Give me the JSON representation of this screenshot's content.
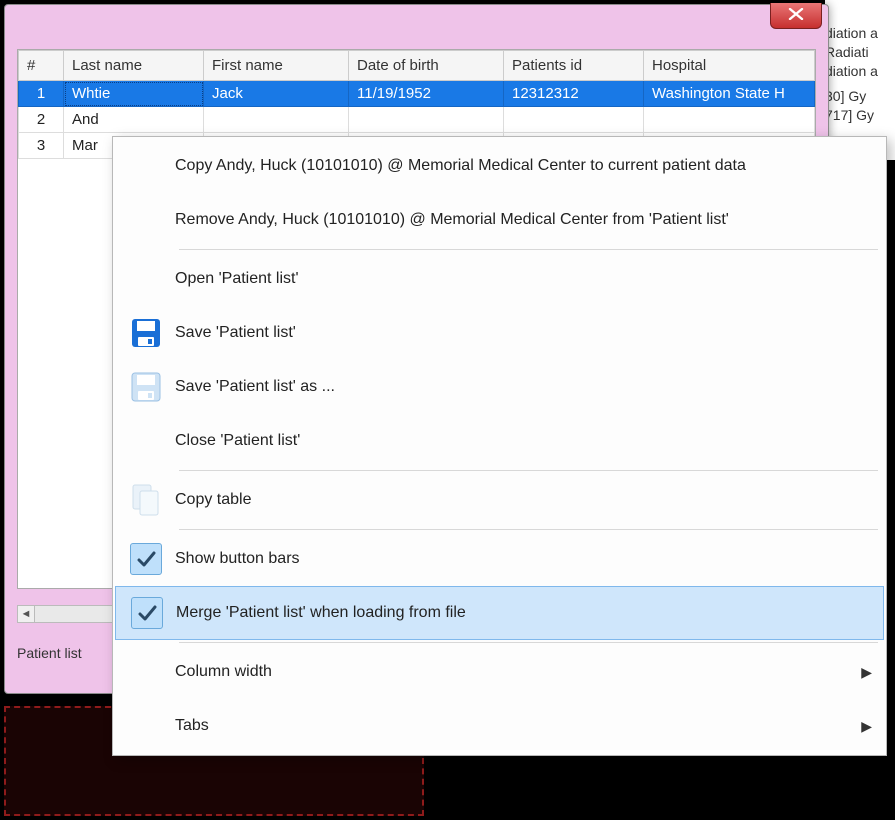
{
  "bg_right": {
    "l1": "diation a",
    "l2": "Radiati",
    "l3": "diation a",
    "l4": "30] Gy",
    "l5": "717] Gy"
  },
  "dialog": {
    "tab_label": "Patient list"
  },
  "table": {
    "headers": {
      "num": "#",
      "last": "Last name",
      "first": "First name",
      "dob": "Date of birth",
      "pid": "Patients id",
      "hosp": "Hospital"
    },
    "rows": [
      {
        "num": "1",
        "last": "Whtie",
        "first": "Jack",
        "dob": "11/19/1952",
        "pid": "12312312",
        "hosp": "Washington State H"
      },
      {
        "num": "2",
        "last": "And",
        "first": "",
        "dob": "",
        "pid": "",
        "hosp": ""
      },
      {
        "num": "3",
        "last": "Mar",
        "first": "",
        "dob": "",
        "pid": "",
        "hosp": ""
      }
    ]
  },
  "ctx": {
    "copy_current": "Copy Andy, Huck (10101010) @ Memorial Medical Center to current patient data",
    "remove": "Remove Andy, Huck (10101010) @ Memorial Medical Center from 'Patient list'",
    "open": "Open 'Patient list'",
    "save": "Save 'Patient list'",
    "save_as": "Save 'Patient list' as ...",
    "close": "Close 'Patient list'",
    "copy_table": "Copy table",
    "show_bars": "Show button bars",
    "merge": "Merge 'Patient list' when loading from file",
    "col_width": "Column width",
    "tabs": "Tabs"
  }
}
